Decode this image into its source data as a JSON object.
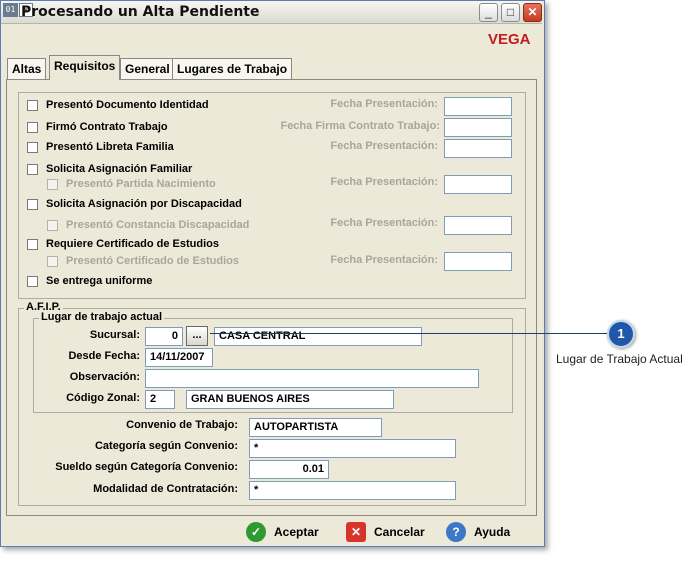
{
  "window": {
    "icon_text": "01",
    "title": "Procesando un Alta Pendiente",
    "brand": "VEGA"
  },
  "tabs": [
    "Altas",
    "Requisitos",
    "General",
    "Lugares de Trabajo"
  ],
  "requisitos": {
    "doc_identidad": "Presentó Documento Identidad",
    "fecha_presentacion_1": "Fecha Presentación:",
    "contrato": "Firmó Contrato Trabajo",
    "fecha_firma": "Fecha Firma Contrato Trabajo:",
    "libreta": "Presentó Libreta Familia",
    "fecha_presentacion_2": "Fecha Presentación:",
    "asig_familiar": "Solicita Asignación Familiar",
    "partida": "Presentó Partida Nacimiento",
    "fecha_presentacion_3": "Fecha Presentación:",
    "asig_discapacidad": "Solicita Asignación por Discapacidad",
    "constancia": "Presentó Constancia Discapacidad",
    "fecha_presentacion_4": "Fecha Presentación:",
    "cert_estudios": "Requiere Certificado de Estudios",
    "presento_cert": "Presentó Certificado de Estudios",
    "fecha_presentacion_5": "Fecha Presentación:",
    "uniforme": "Se entrega uniforme"
  },
  "afip": {
    "legend": "A.F.I.P.",
    "lugar_legend": "Lugar de trabajo actual",
    "sucursal_label": "Sucursal:",
    "sucursal_code": "0",
    "lookup_button": "...",
    "sucursal_name": "CASA CENTRAL",
    "desde_label": "Desde Fecha:",
    "desde_value": "14/11/2007",
    "observacion_label": "Observación:",
    "observacion_value": "",
    "zonal_label": "Código Zonal:",
    "zonal_code": "2",
    "zonal_name": "GRAN BUENOS AIRES",
    "convenio_label": "Convenio de Trabajo:",
    "convenio_value": "AUTOPARTISTA",
    "categoria_label": "Categoría según Convenio:",
    "categoria_value": "*",
    "sueldo_label": "Sueldo según Categoría Convenio:",
    "sueldo_value": "0.01",
    "modalidad_label": "Modalidad de Contratación:",
    "modalidad_value": "*"
  },
  "buttons": {
    "accept": "Aceptar",
    "cancel": "Cancelar",
    "help": "Ayuda"
  },
  "callout": {
    "number": "1",
    "text": "Lugar de Trabajo Actual"
  },
  "colors": {
    "brand": "#c31e1e",
    "callout": "#1f58a8",
    "accept": "#2f9a2f",
    "cancel": "#d9342b",
    "help": "#3b78c8"
  }
}
